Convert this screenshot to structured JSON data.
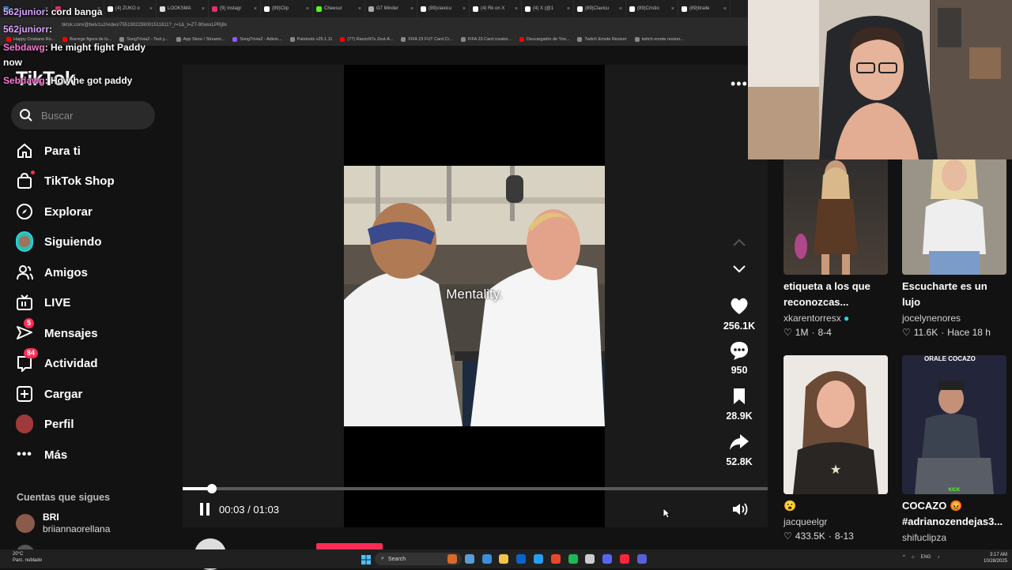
{
  "browser": {
    "tabs": [
      {
        "label": "",
        "color": "#1da1f2"
      },
      {
        "label": "",
        "color": "#e1306c"
      },
      {
        "label": "(4) ZUKO o",
        "color": "#ffffff"
      },
      {
        "label": "LOOKSMA",
        "color": "#dddddd"
      },
      {
        "label": "(9) Instagr",
        "color": "#e1306c"
      },
      {
        "label": "(89)Clip",
        "color": "#ffffff"
      },
      {
        "label": "Cheesur",
        "color": "#53fc18"
      },
      {
        "label": "G7 Minder",
        "color": "#aaaaaa"
      },
      {
        "label": "(89)clavicu",
        "color": "#ffffff"
      },
      {
        "label": "(4) Rk on X",
        "color": "#ffffff"
      },
      {
        "label": "(4) X (@1",
        "color": "#ffffff"
      },
      {
        "label": "(89)Clavicu",
        "color": "#ffffff"
      },
      {
        "label": "(89)Cristio",
        "color": "#ffffff"
      },
      {
        "label": "(89)Itraile",
        "color": "#ffffff"
      }
    ],
    "address": "tiktok.com/@belv1s2/video/7551902259001511811?_r=1&_t=ZT-90wxxLPRj8x",
    "bookmarks": [
      {
        "label": "Happy Cristiano Ro...",
        "color": "#ff0000"
      },
      {
        "label": "Burrego figura de lo...",
        "color": "#ff0000"
      },
      {
        "label": "SongTrivia2 - Test y...",
        "color": "#888888"
      },
      {
        "label": "App Store / Streami...",
        "color": "#888888"
      },
      {
        "label": "SongTrivia2 - Adivin...",
        "color": "#8a5cf6"
      },
      {
        "label": "Paletools v25.1.11",
        "color": "#888888"
      },
      {
        "label": "(77) Razzo97s Zest-A...",
        "color": "#ff0000"
      },
      {
        "label": "FIFA 23 FUT Card Cr...",
        "color": "#888888"
      },
      {
        "label": "FIFA 23 Card creator...",
        "color": "#888888"
      },
      {
        "label": "Descargador de Yoo...",
        "color": "#ff0000"
      },
      {
        "label": "Twitch Emote Resizer",
        "color": "#888888"
      },
      {
        "label": "twitch emote resizer...",
        "color": "#888888"
      }
    ]
  },
  "chat": [
    {
      "user": "562junior",
      "text": ": cord banga"
    },
    {
      "user": "562juniorr",
      "text": ":"
    },
    {
      "user": "Sebdawg",
      "text": ": He might fight Paddy"
    },
    {
      "user": "",
      "text": "now"
    },
    {
      "user": "Sebdawg",
      "text": ": How he got paddy"
    }
  ],
  "sidebar": {
    "logo": "TikTok",
    "search_placeholder": "Buscar",
    "items": [
      {
        "label": "Para ti",
        "icon": "home-icon"
      },
      {
        "label": "TikTok Shop",
        "icon": "shop-icon"
      },
      {
        "label": "Explorar",
        "icon": "compass-icon"
      },
      {
        "label": "Siguiendo",
        "icon": "following-avatar-icon"
      },
      {
        "label": "Amigos",
        "icon": "friends-icon"
      },
      {
        "label": "LIVE",
        "icon": "live-icon"
      },
      {
        "label": "Mensajes",
        "icon": "messages-icon",
        "badge": "5"
      },
      {
        "label": "Actividad",
        "icon": "activity-icon",
        "badge": "84"
      },
      {
        "label": "Cargar",
        "icon": "upload-icon"
      },
      {
        "label": "Perfil",
        "icon": "profile-avatar-icon"
      },
      {
        "label": "Más",
        "icon": "more-icon"
      }
    ],
    "following_title": "Cuentas que sigues",
    "following": [
      {
        "name": "BRI",
        "username": "briiannaorellana"
      }
    ]
  },
  "video": {
    "caption": "Mentality.",
    "likes": "256.1K",
    "comments": "950",
    "saves": "28.9K",
    "shares": "52.8K",
    "time_current": "00:03",
    "time_total": "01:03",
    "progress": 0.05,
    "creator": "belv1s2",
    "accent": "#fe2c55"
  },
  "recommended": [
    {
      "title": "etiqueta a los que reconozcas...",
      "user": "xkarentorresx",
      "verified": true,
      "likes": "1M",
      "date": "8-4"
    },
    {
      "title": "Escucharte es un lujo",
      "user": "jocelynenores",
      "verified": false,
      "likes": "11.6K",
      "date": "Hace 18 h"
    },
    {
      "title": "😮",
      "user": "jacqueelgr",
      "verified": false,
      "likes": "433.5K",
      "date": "8-13"
    },
    {
      "title": "COCAZO 😡 #adrianozendejas3...",
      "user": "shifuclipza",
      "verified": false,
      "likes": "",
      "date": ""
    }
  ],
  "thumb_overlay": "ORALE COCAZO",
  "thumb_badge": "KICK",
  "taskbar": {
    "search": "Search",
    "weather_temp": "20°C",
    "weather_desc": "Parc. nublado",
    "time": "3:17 AM",
    "date": "10/28/2025",
    "lang": "ENG"
  }
}
